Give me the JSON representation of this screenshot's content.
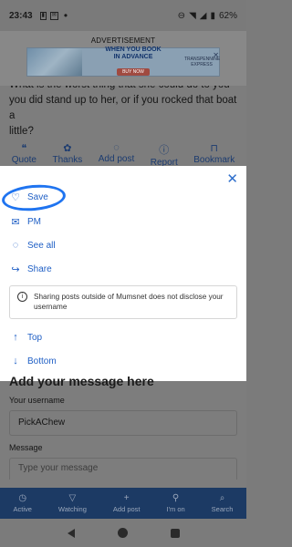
{
  "status_bar": {
    "time": "23:43",
    "icons_left": [
      "message-icon",
      "mail-icon",
      "notification-icon"
    ],
    "battery": "62%",
    "icons_right": [
      "dnd-icon",
      "wifi-icon",
      "signal-icon",
      "battery-icon"
    ]
  },
  "advertisement": {
    "label": "ADVERTISEMENT",
    "headline_1": "WHEN YOU BOOK",
    "headline_2": "IN ADVANCE",
    "cta": "BUY NOW",
    "brand_1": "TRANSPENNINE",
    "brand_2": "EXPRESS"
  },
  "post": {
    "line_1": "What is the worst thing that she could do to you if",
    "line_2": "you did stand up to her, or if you rocked that boat a",
    "line_3": "little?"
  },
  "post_actions": [
    {
      "label": "Quote",
      "icon": "quote-icon"
    },
    {
      "label": "Thanks",
      "icon": "thanks-icon"
    },
    {
      "label": "Add post",
      "icon": "add-post-icon"
    },
    {
      "label": "Report",
      "icon": "report-icon"
    },
    {
      "label": "Bookmark",
      "icon": "bookmark-icon"
    }
  ],
  "sheet": {
    "items": [
      {
        "label": "Save",
        "icon": "heart-icon"
      },
      {
        "label": "PM",
        "icon": "mail-icon"
      },
      {
        "label": "See all",
        "icon": "chat-icon"
      },
      {
        "label": "Share",
        "icon": "share-icon"
      }
    ],
    "share_note": "Sharing posts outside of Mumsnet does not disclose your username",
    "nav_items": [
      {
        "label": "Top",
        "icon": "arrow-up-icon"
      },
      {
        "label": "Bottom",
        "icon": "arrow-down-icon"
      }
    ],
    "accent_color": "#1f5fc5",
    "highlight_color": "#1f74f0"
  },
  "form": {
    "heading": "Add your message here",
    "username_label": "Your username",
    "username_value": "PickAChew",
    "message_label": "Message",
    "message_placeholder": "Type your message"
  },
  "bottom_nav": [
    {
      "label": "Active",
      "icon": "clock-icon"
    },
    {
      "label": "Watching",
      "icon": "filter-icon"
    },
    {
      "label": "Add post",
      "icon": "plus-icon"
    },
    {
      "label": "I'm on",
      "icon": "pin-icon"
    },
    {
      "label": "Search",
      "icon": "search-icon"
    }
  ]
}
